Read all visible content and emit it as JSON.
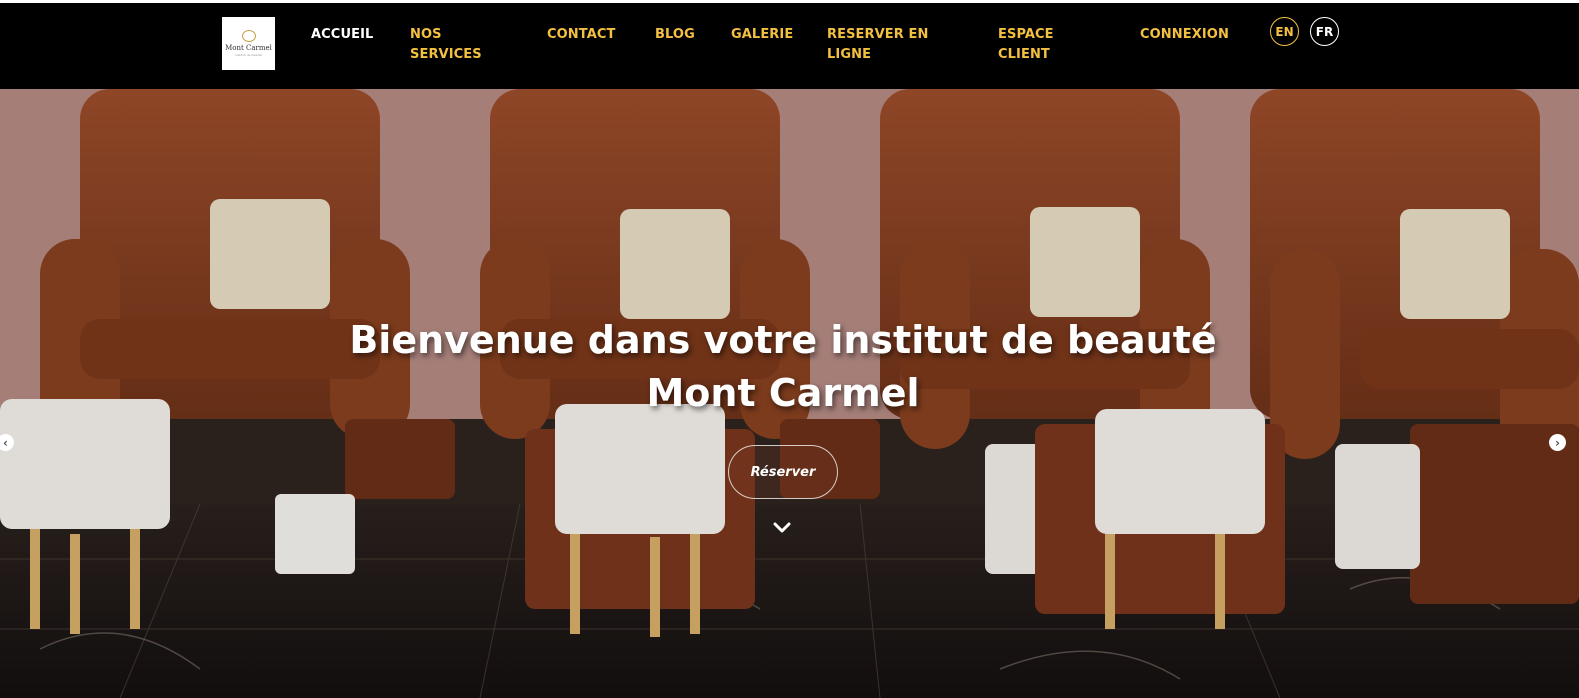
{
  "brand": {
    "logo_name": "Mont Carmel",
    "logo_subtitle": "institut de beauté"
  },
  "nav": {
    "accueil": "ACCUEIL",
    "nos_services_1": "NOS",
    "nos_services_2": "SERVICES",
    "contact": "CONTACT",
    "blog": "BLOG",
    "galerie": "GALERIE",
    "reserver_1": "RESERVER EN",
    "reserver_2": "LIGNE",
    "espace_1": "ESPACE",
    "espace_2": "CLIENT",
    "connexion": "CONNEXION"
  },
  "lang": {
    "en": "EN",
    "fr": "FR"
  },
  "hero": {
    "title_line1": "Bienvenue dans votre institut de beauté",
    "title_line2": "Mont Carmel",
    "cta": "Réserver"
  },
  "icons": {
    "prev": "chevron-left-icon",
    "next": "chevron-right-icon",
    "scroll": "chevron-down-icon"
  },
  "colors": {
    "accent": "#f4c041",
    "nav_bg": "#000000",
    "active": "#ffffff"
  }
}
